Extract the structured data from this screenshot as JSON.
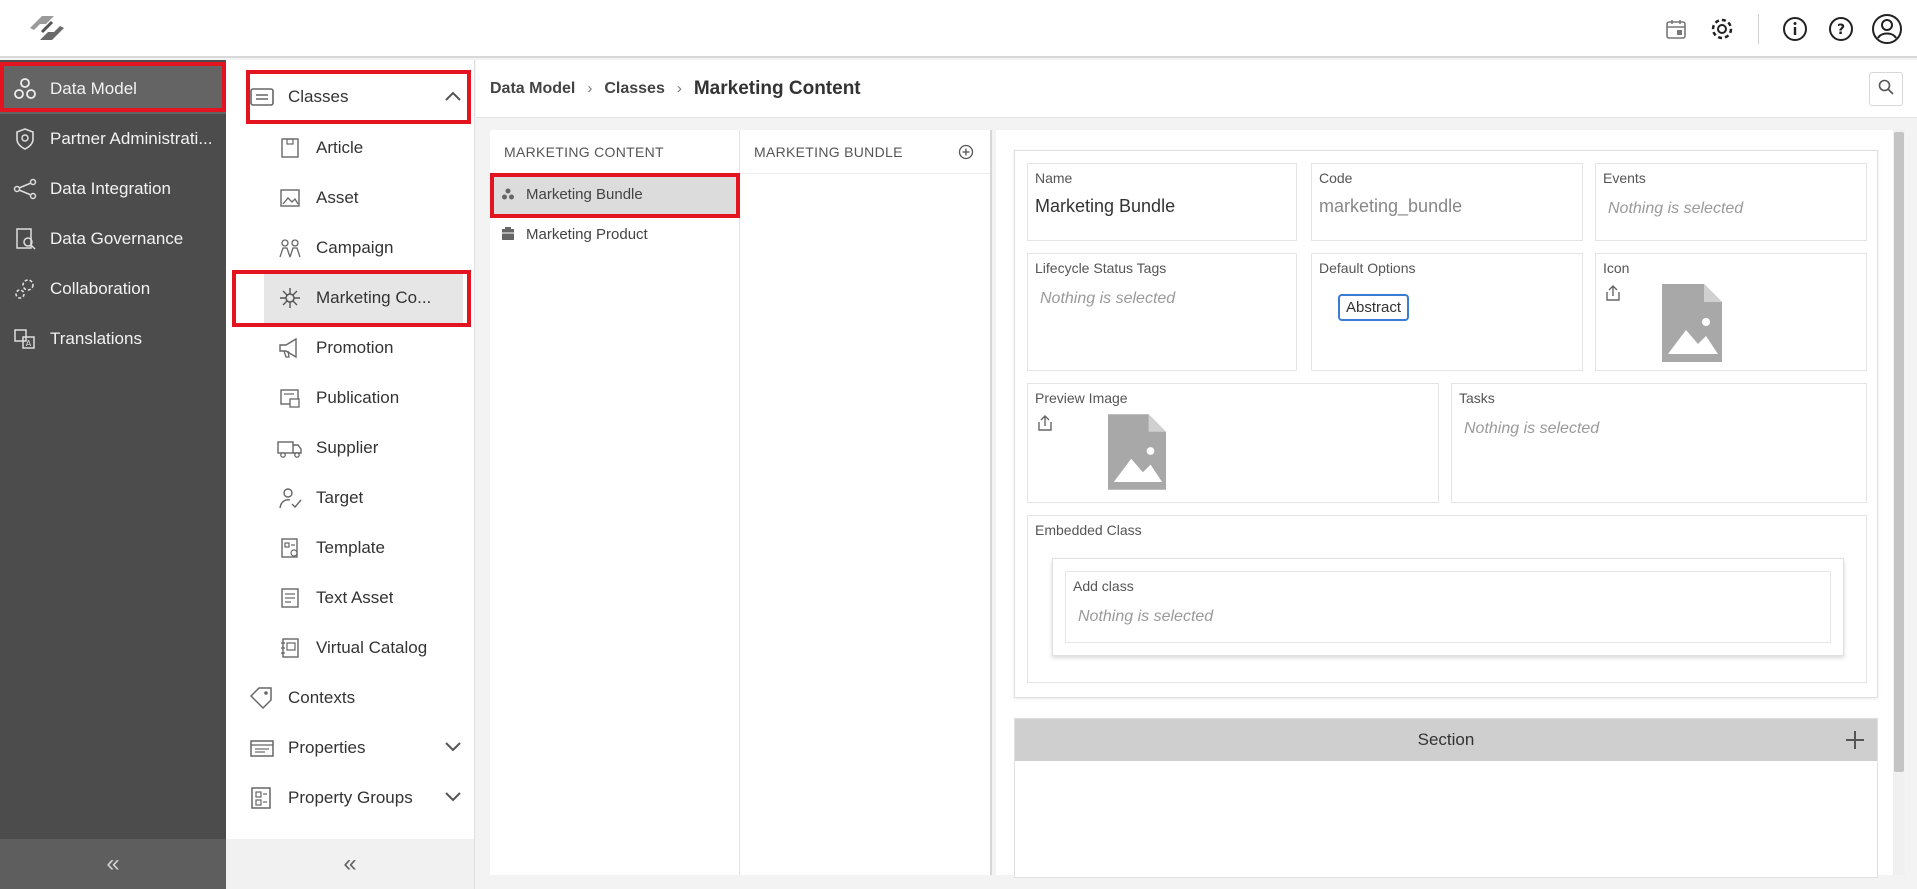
{
  "app": {
    "logo_icon": "app-logo-icon"
  },
  "topbar": {
    "icons": [
      "calendar-icon",
      "gear-icon",
      "info-icon",
      "help-icon",
      "user-icon"
    ]
  },
  "sidebar1": {
    "items": [
      {
        "label": "Data Model",
        "icon": "data-model-icon",
        "active": true
      },
      {
        "label": "Partner Administrati...",
        "icon": "shield-icon"
      },
      {
        "label": "Data Integration",
        "icon": "integration-icon"
      },
      {
        "label": "Data Governance",
        "icon": "governance-icon"
      },
      {
        "label": "Collaboration",
        "icon": "collaboration-icon"
      },
      {
        "label": "Translations",
        "icon": "translations-icon"
      }
    ],
    "collapse_label": "«"
  },
  "sidebar2": {
    "classes_label": "Classes",
    "sub_items": [
      {
        "label": "Article",
        "icon": "article-icon"
      },
      {
        "label": "Asset",
        "icon": "asset-icon"
      },
      {
        "label": "Campaign",
        "icon": "campaign-icon"
      },
      {
        "label": "Marketing Co...",
        "icon": "marketing-content-icon",
        "selected": true
      },
      {
        "label": "Promotion",
        "icon": "megaphone-icon"
      },
      {
        "label": "Publication",
        "icon": "publication-icon"
      },
      {
        "label": "Supplier",
        "icon": "truck-icon"
      },
      {
        "label": "Target",
        "icon": "target-icon"
      },
      {
        "label": "Template",
        "icon": "template-icon"
      },
      {
        "label": "Text Asset",
        "icon": "text-asset-icon"
      },
      {
        "label": "Virtual Catalog",
        "icon": "virtual-catalog-icon"
      }
    ],
    "contexts_label": "Contexts",
    "properties_label": "Properties",
    "property_groups_label": "Property Groups",
    "collapse_label": "«"
  },
  "breadcrumb": {
    "items": [
      "Data Model",
      "Classes"
    ],
    "current": "Marketing Content",
    "separator": "›"
  },
  "columns": {
    "col1_header": "MARKETING CONTENT",
    "col1_rows": [
      {
        "label": "Marketing Bundle",
        "selected": true
      },
      {
        "label": "Marketing Product"
      }
    ],
    "col2_header": "MARKETING BUNDLE"
  },
  "detail": {
    "name_label": "Name",
    "name_value": "Marketing Bundle",
    "code_label": "Code",
    "code_value": "marketing_bundle",
    "events_label": "Events",
    "events_value": "Nothing is selected",
    "lifecycle_label": "Lifecycle Status Tags",
    "lifecycle_value": "Nothing is selected",
    "default_options_label": "Default Options",
    "default_option_chip": "Abstract",
    "icon_label": "Icon",
    "preview_label": "Preview Image",
    "tasks_label": "Tasks",
    "tasks_value": "Nothing is selected",
    "embedded_label": "Embedded Class",
    "add_class_label": "Add class",
    "add_class_value": "Nothing is selected",
    "section_label": "Section"
  },
  "colors": {
    "highlight": "#e3141f",
    "sidebar_dark": "#4c4c4c",
    "chip_border": "#3a7bd5"
  }
}
